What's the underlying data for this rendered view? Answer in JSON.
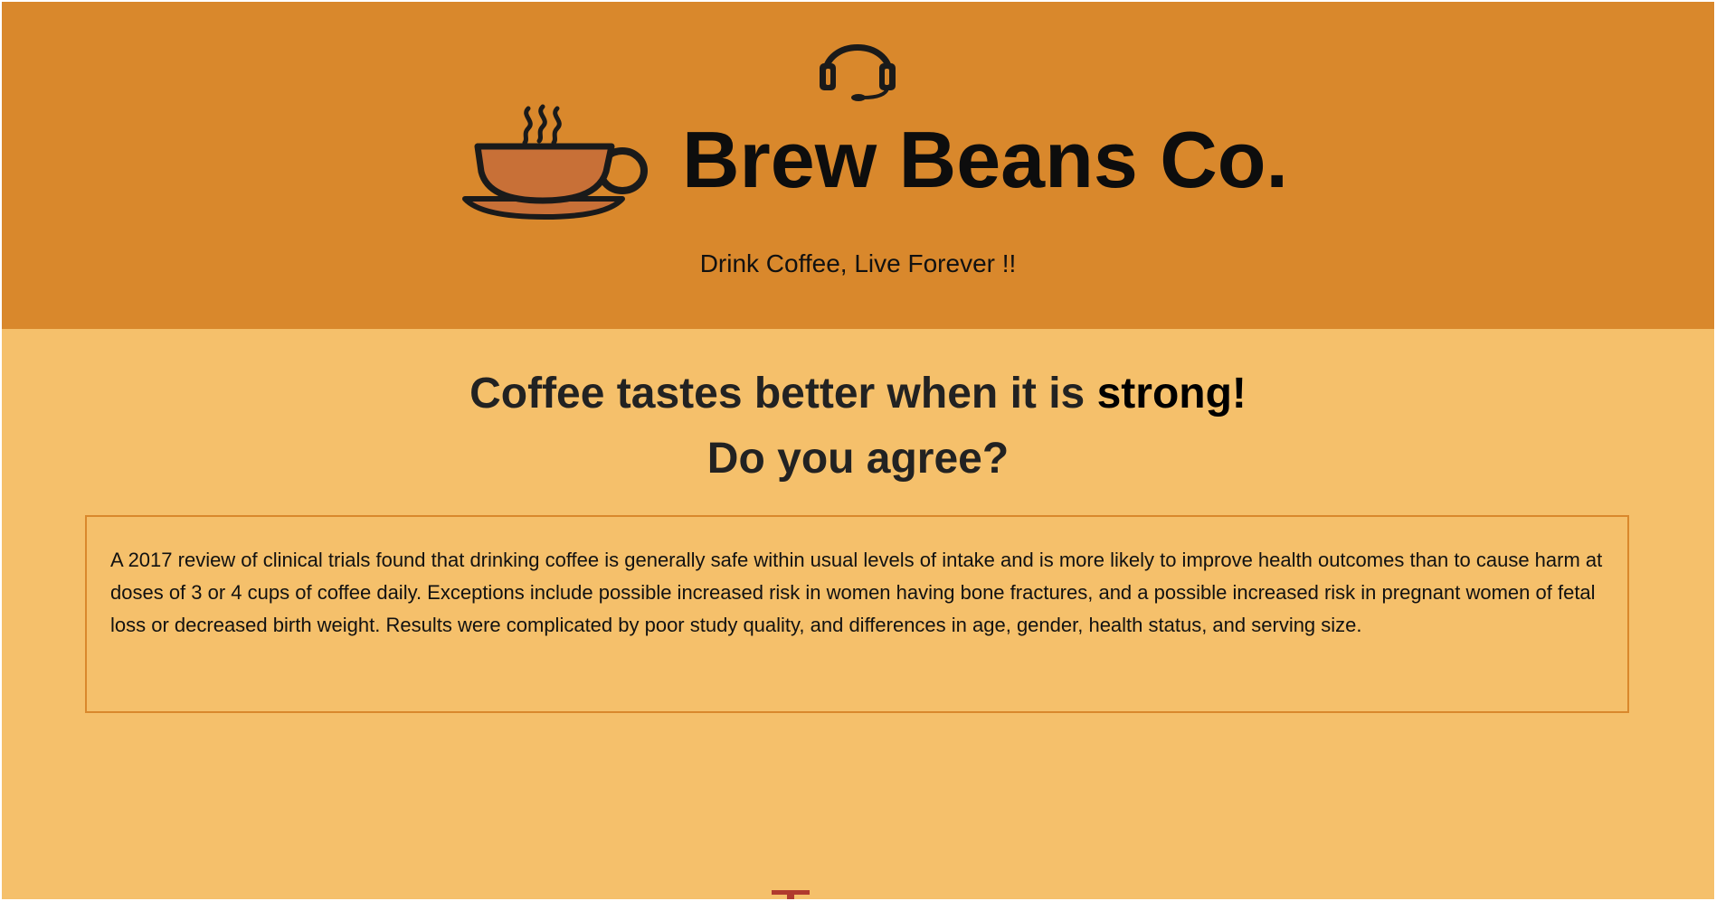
{
  "header": {
    "brand_name": "Brew Beans Co.",
    "tagline": "Drink Coffee, Live Forever !!",
    "support_icon": "headset-icon",
    "logo_icon": "coffee-cup-icon",
    "background_color": "#d9882c"
  },
  "main": {
    "headline_part1": "Coffee tastes better when it is ",
    "headline_emphasis": "strong!",
    "headline_line2": "Do you agree?",
    "info_text": "A 2017 review of clinical trials found that drinking coffee is generally safe within usual levels of intake and is more likely to improve health outcomes than to cause harm at doses of 3 or 4 cups of coffee daily. Exceptions include possible increased risk in women having bone fractures, and a possible increased risk in pregnant women of fetal loss or decreased birth weight. Results were complicated by poor study quality, and differences in age, gender, health status, and serving size.",
    "background_color": "#f5c06b",
    "box_border_color": "#d9882c"
  },
  "colors": {
    "cup_fill": "#c87037",
    "mark_red": "#b03a2e"
  }
}
